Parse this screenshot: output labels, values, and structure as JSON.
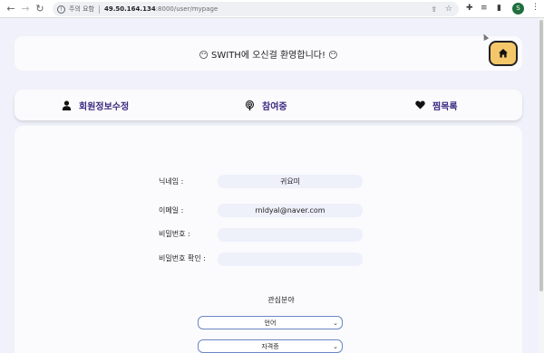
{
  "browser": {
    "warning_text": "주의 요함",
    "url_host": "49.50.164.134",
    "url_rest": ":8000/user/mypage",
    "profile_initial": "S"
  },
  "banner": {
    "text": "😶 SWITH에 오신걸 환영합니다! 😶"
  },
  "tabs": [
    {
      "label": "회원정보수정",
      "icon": "user-icon"
    },
    {
      "label": "참여중",
      "icon": "podcast-icon"
    },
    {
      "label": "찜목록",
      "icon": "heart-icon"
    }
  ],
  "form": {
    "nickname_label": "닉네임 :",
    "nickname_value": "귀요미",
    "email_label": "이메일 :",
    "email_value": "rnldyal@naver.com",
    "password_label": "비밀번호 :",
    "password_confirm_label": "비밀번호 확인 :"
  },
  "interests": {
    "title": "관심분야",
    "select1": "언어",
    "select2": "자격증"
  },
  "colors": {
    "accent": "#3d2a80",
    "home_button": "#f5c76b",
    "field_bg": "#eef0fa"
  }
}
